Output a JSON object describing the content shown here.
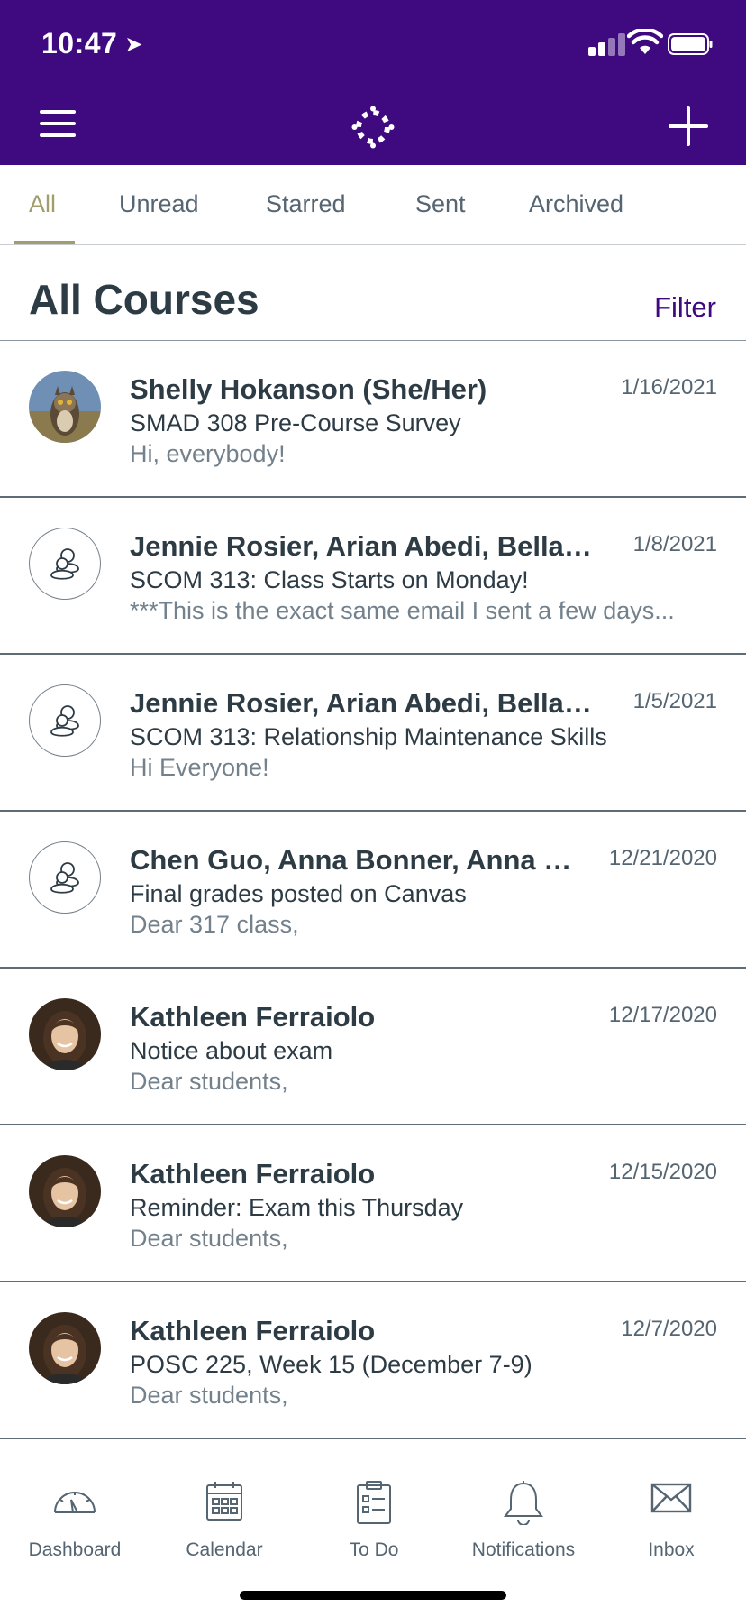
{
  "status_bar": {
    "time": "10:47"
  },
  "header": {
    "menu_icon": "hamburger-icon",
    "logo_icon": "canvas-logo-icon",
    "compose_icon": "plus-icon"
  },
  "tabs": [
    {
      "label": "All",
      "active": true
    },
    {
      "label": "Unread"
    },
    {
      "label": "Starred"
    },
    {
      "label": "Sent"
    },
    {
      "label": "Archived"
    }
  ],
  "section": {
    "title": "All Courses",
    "filter_label": "Filter"
  },
  "messages": [
    {
      "name": "Shelly Hokanson (She/Her)",
      "date": "1/16/2021",
      "subject": "SMAD 308 Pre-Course Survey",
      "preview": "Hi, everybody!",
      "avatar": "owl-photo"
    },
    {
      "name": "Jennie Rosier, Arian Abedi, Bella T...",
      "date": "1/8/2021",
      "subject": "SCOM 313: Class Starts on Monday!",
      "preview": "***This is the exact same email I sent a few days...",
      "avatar": "group-icon"
    },
    {
      "name": "Jennie Rosier, Arian Abedi, Bella T...",
      "date": "1/5/2021",
      "subject": "SCOM 313: Relationship Maintenance Skills",
      "preview": "Hi Everyone!",
      "avatar": "group-icon"
    },
    {
      "name": "Chen Guo, Anna Bonner, Anna Ly...",
      "date": "12/21/2020",
      "subject": "Final grades posted on Canvas",
      "preview": "Dear 317 class,",
      "avatar": "group-icon"
    },
    {
      "name": "Kathleen Ferraiolo",
      "date": "12/17/2020",
      "subject": "Notice about exam",
      "preview": "Dear students,",
      "avatar": "person-photo"
    },
    {
      "name": "Kathleen Ferraiolo",
      "date": "12/15/2020",
      "subject": "Reminder: Exam this Thursday",
      "preview": "Dear students,",
      "avatar": "person-photo"
    },
    {
      "name": "Kathleen Ferraiolo",
      "date": "12/7/2020",
      "subject": "POSC 225, Week 15 (December 7-9)",
      "preview": "Dear students,",
      "avatar": "person-photo"
    }
  ],
  "bottom_nav": [
    {
      "label": "Dashboard",
      "icon": "dashboard-icon"
    },
    {
      "label": "Calendar",
      "icon": "calendar-icon"
    },
    {
      "label": "To Do",
      "icon": "todo-icon"
    },
    {
      "label": "Notifications",
      "icon": "bell-icon"
    },
    {
      "label": "Inbox",
      "icon": "inbox-icon"
    }
  ],
  "colors": {
    "brand": "#3f0a80",
    "tab_active": "#a19d6d",
    "text": "#2d3b45",
    "muted": "#556572"
  }
}
